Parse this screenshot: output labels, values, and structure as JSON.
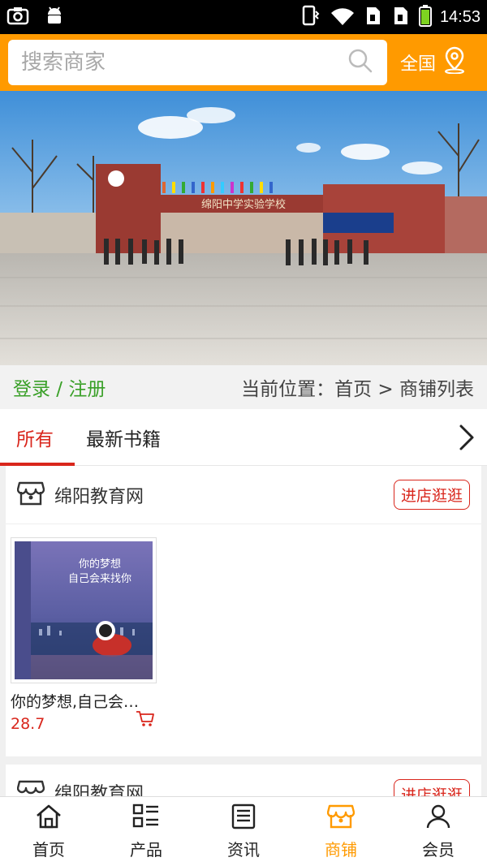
{
  "status_bar": {
    "time": "14:53"
  },
  "search": {
    "placeholder": "搜索商家",
    "region_label": "全国"
  },
  "info_bar": {
    "login_label": "登录 / 注册",
    "breadcrumb": "当前位置：首页 > 商铺列表"
  },
  "tabs": [
    {
      "label": "所有",
      "active": true
    },
    {
      "label": "最新书籍",
      "active": false
    }
  ],
  "shops": [
    {
      "name": "绵阳教育网",
      "visit_label": "进店逛逛",
      "products": [
        {
          "title": "你的梦想,自己会…",
          "price": "28.7",
          "cover_title_line1": "你的梦想",
          "cover_title_line2": "自己会来找你"
        }
      ]
    },
    {
      "name": "绵阳教育网",
      "visit_label": "进店逛逛"
    }
  ],
  "banner": {
    "sign_text": "绵阳中学实验学校"
  },
  "bottom_nav": [
    {
      "label": "首页",
      "icon": "home-icon",
      "active": false
    },
    {
      "label": "产品",
      "icon": "grid-list-icon",
      "active": false
    },
    {
      "label": "资讯",
      "icon": "news-icon",
      "active": false
    },
    {
      "label": "商铺",
      "icon": "shop-icon",
      "active": true
    },
    {
      "label": "会员",
      "icon": "user-icon",
      "active": false
    }
  ],
  "colors": {
    "accent": "#ff9a00",
    "red": "#d9261c",
    "green": "#3aa028"
  }
}
